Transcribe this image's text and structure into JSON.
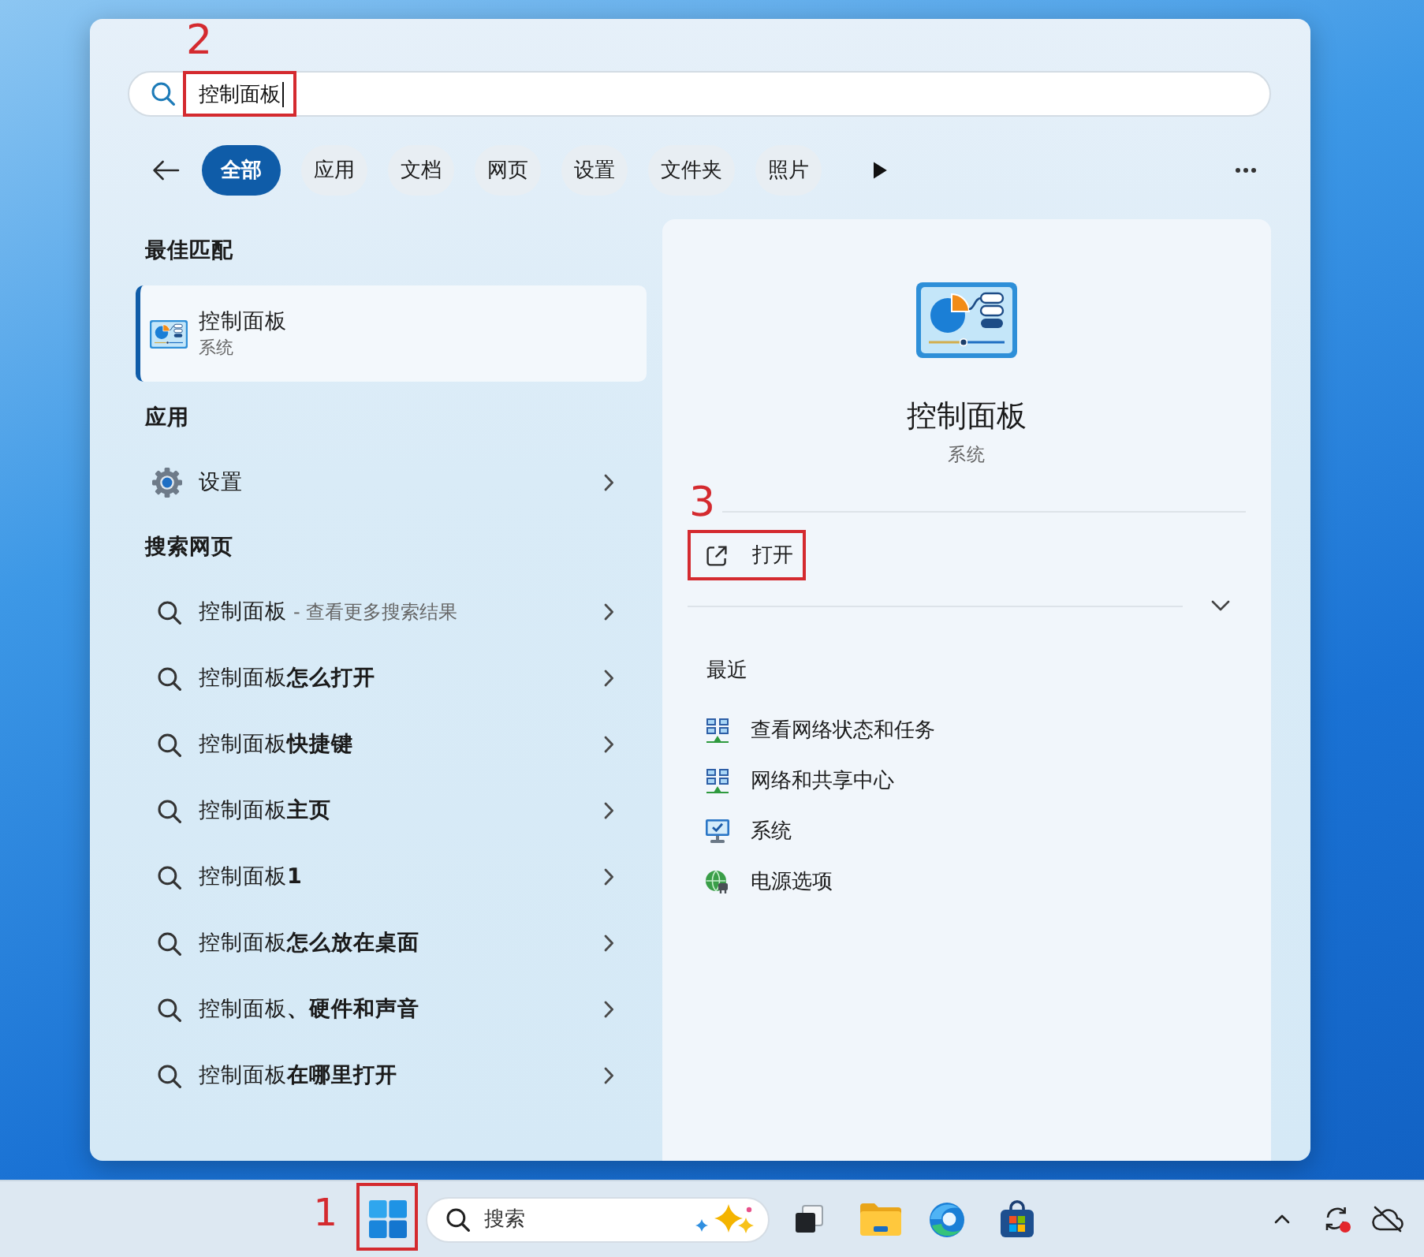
{
  "search": {
    "value": "控制面板",
    "callout": "2"
  },
  "filters": [
    {
      "label": "全部",
      "selected": true
    },
    {
      "label": "应用",
      "selected": false
    },
    {
      "label": "文档",
      "selected": false
    },
    {
      "label": "网页",
      "selected": false
    },
    {
      "label": "设置",
      "selected": false
    },
    {
      "label": "文件夹",
      "selected": false
    },
    {
      "label": "照片",
      "selected": false
    }
  ],
  "best_match": {
    "heading": "最佳匹配",
    "items": [
      {
        "title": "控制面板",
        "subtitle": "系统",
        "selected": true
      }
    ]
  },
  "apps": {
    "heading": "应用",
    "items": [
      {
        "label": "设置"
      }
    ]
  },
  "web_search": {
    "heading": "搜索网页",
    "items": [
      {
        "text": "控制面板",
        "hint": "- 查看更多搜索结果"
      },
      {
        "text": "控制面板**怎么打开**"
      },
      {
        "text": "控制面板**快捷键**"
      },
      {
        "text": "控制面板**主页**"
      },
      {
        "text": "控制面板**1**"
      },
      {
        "text": "控制面板**怎么放在桌面**"
      },
      {
        "text": "控制面板**、硬件和声音**"
      },
      {
        "text": "控制面板**在哪里打开**"
      }
    ]
  },
  "detail": {
    "title": "控制面板",
    "subtitle": "系统",
    "actions": [
      {
        "label": "打开",
        "callout": "3"
      }
    ],
    "recent_heading": "最近",
    "recent": [
      {
        "label": "查看网络状态和任务",
        "kind": "network"
      },
      {
        "label": "网络和共享中心",
        "kind": "network"
      },
      {
        "label": "系统",
        "kind": "system"
      },
      {
        "label": "电源选项",
        "kind": "power"
      }
    ]
  },
  "taskbar": {
    "start_callout": "1",
    "search": {
      "placeholder": "搜索"
    }
  }
}
